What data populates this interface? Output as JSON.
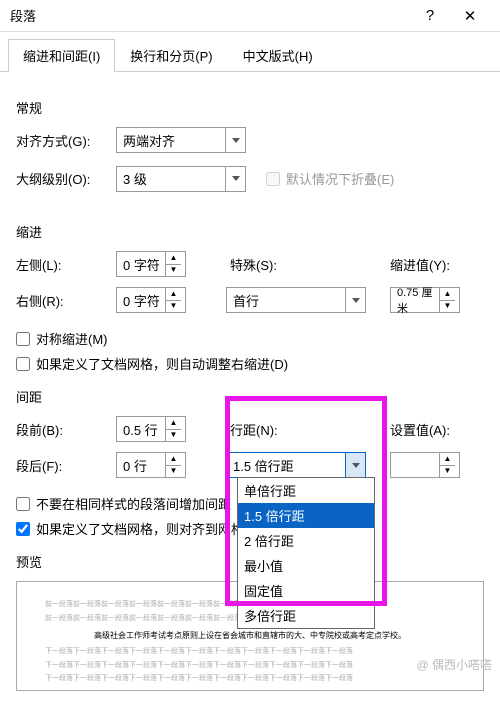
{
  "title": "段落",
  "tabs": {
    "t0": "缩进和间距(I)",
    "t1": "换行和分页(P)",
    "t2": "中文版式(H)"
  },
  "general": {
    "header": "常规",
    "align_label": "对齐方式(G):",
    "align_value": "两端对齐",
    "outline_label": "大纲级别(O):",
    "outline_value": "3 级",
    "collapse_label": "默认情况下折叠(E)"
  },
  "indent": {
    "header": "缩进",
    "left_label": "左侧(L):",
    "left_value": "0 字符",
    "right_label": "右侧(R):",
    "right_value": "0 字符",
    "special_label": "特殊(S):",
    "special_value": "首行",
    "by_label": "缩进值(Y):",
    "by_value": "0.75 厘米",
    "mirror_label": "对称缩进(M)",
    "grid_label": "如果定义了文档网格，则自动调整右缩进(D)"
  },
  "spacing": {
    "header": "间距",
    "before_label": "段前(B):",
    "before_value": "0.5 行",
    "after_label": "段后(F):",
    "after_value": "0 行",
    "line_label": "行距(N):",
    "line_value": "1.5 倍行距",
    "at_label": "设置值(A):",
    "at_value": "",
    "nostyle_label": "不要在相同样式的段落间增加间距",
    "grid_label": "如果定义了文档网格，则对齐到网格"
  },
  "dropdown": {
    "opt0": "单倍行距",
    "opt1": "1.5 倍行距",
    "opt2": "2 倍行距",
    "opt3": "最小值",
    "opt4": "固定值",
    "opt5": "多倍行距"
  },
  "preview": {
    "header": "预览",
    "gray": "前一段落前一段落前一段落前一段落前一段落前一段落前一段落前一段落前一段落前一段落前一段落",
    "black": "高级社会工作师考试考点原则上设在省会城市和直辖市的大、中专院校或高考定点学校。",
    "gray2": "下一段落下一段落下一段落下一段落下一段落下一段落下一段落下一段落下一段落下一段落下一段落"
  },
  "watermark": "@ 偶西小嗒嗒"
}
